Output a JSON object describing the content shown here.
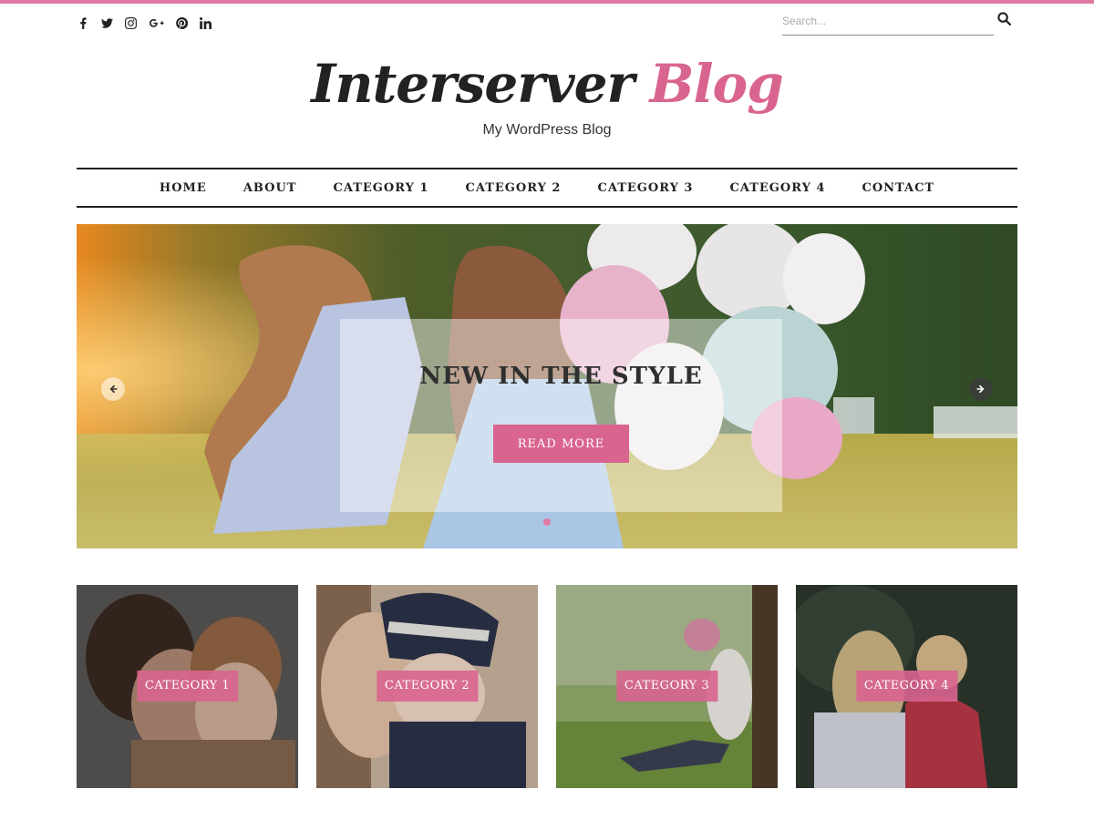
{
  "colors": {
    "accent": "#d9648f",
    "top_bar": "#e07aa3",
    "text": "#222222"
  },
  "social": [
    {
      "icon": "facebook-icon"
    },
    {
      "icon": "twitter-icon"
    },
    {
      "icon": "instagram-icon"
    },
    {
      "icon": "google-plus-icon"
    },
    {
      "icon": "pinterest-icon"
    },
    {
      "icon": "linkedin-icon"
    }
  ],
  "search": {
    "placeholder": "Search...",
    "button_icon": "search-icon"
  },
  "site": {
    "title_part1": "Interserver",
    "title_part2": "Blog",
    "tagline": "My WordPress Blog"
  },
  "nav": {
    "items": [
      {
        "label": "HOME"
      },
      {
        "label": "ABOUT"
      },
      {
        "label": "CATEGORY 1"
      },
      {
        "label": "CATEGORY 2"
      },
      {
        "label": "CATEGORY 3"
      },
      {
        "label": "CATEGORY 4"
      },
      {
        "label": "CONTACT"
      }
    ]
  },
  "slider": {
    "title": "NEW IN THE STYLE",
    "button": "READ MORE",
    "prev_icon": "arrow-left-icon",
    "next_icon": "arrow-right-icon"
  },
  "categories": [
    {
      "label": "CATEGORY 1"
    },
    {
      "label": "CATEGORY 2"
    },
    {
      "label": "CATEGORY 3"
    },
    {
      "label": "CATEGORY 4"
    }
  ]
}
